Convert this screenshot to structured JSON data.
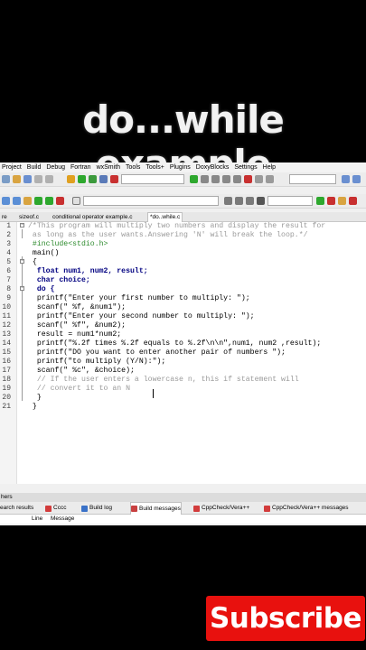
{
  "overlay_title": "do...while example",
  "menu": [
    "Project",
    "Build",
    "Debug",
    "Fortran",
    "wxSmith",
    "Tools",
    "Tools+",
    "Plugins",
    "DoxyBlocks",
    "Settings",
    "Help"
  ],
  "tabs": [
    "re",
    "sizeof.c",
    "conditional operator example.c",
    "*do..while.c"
  ],
  "lines": [
    {
      "n": "1",
      "text": "/*This program will multiply two numbers and display the result for"
    },
    {
      "n": "2",
      "text": " as long as the user wants.Answering 'N' will break the loop.*/"
    },
    {
      "n": "3",
      "text": " #include<stdio.h>"
    },
    {
      "n": "4",
      "text": " main()"
    },
    {
      "n": "5",
      "text": " {"
    },
    {
      "n": "6",
      "text": "  float num1, num2, result;"
    },
    {
      "n": "7",
      "text": "  char choice;"
    },
    {
      "n": "8",
      "text": "  do {"
    },
    {
      "n": "9",
      "text": "  printf(\"Enter your first number to multiply: \");"
    },
    {
      "n": "10",
      "text": "  scanf(\" %f, &num1\");"
    },
    {
      "n": "11",
      "text": "  printf(\"Enter your second number to multiply: \");"
    },
    {
      "n": "12",
      "text": "  scanf(\" %f\", &num2);"
    },
    {
      "n": "13",
      "text": "  result = num1*num2;"
    },
    {
      "n": "14",
      "text": "  printf(\"%.2f times %.2f equals to %.2f\\n\\n\",num1, num2 ,result);"
    },
    {
      "n": "15",
      "text": "  printf(\"DO you want to enter another pair of numbers \");"
    },
    {
      "n": "16",
      "text": "  printf(\"to multiply (Y/N):\");"
    },
    {
      "n": "17",
      "text": "  scanf(\" %c\", &choice);"
    },
    {
      "n": "18",
      "text": "  // If the user enters a lowercase n, this if statement will"
    },
    {
      "n": "19",
      "text": "  // convert it to an N"
    },
    {
      "n": "20",
      "text": "  }"
    },
    {
      "n": "21",
      "text": " }"
    }
  ],
  "panel": {
    "title": "hers",
    "tabs": [
      "earch results",
      "Cccc",
      "Build log",
      "Build messages",
      "CppCheck/Vera++",
      "CppCheck/Vera++ messages"
    ],
    "col_line": "Line",
    "col_message": "Message"
  },
  "subscribe_label": "Subscribe",
  "colors": {
    "subscribe": "#e8110e",
    "comment": "#9a9a9a",
    "preprocessor": "#2e8b2e",
    "keyword": "#000080"
  }
}
